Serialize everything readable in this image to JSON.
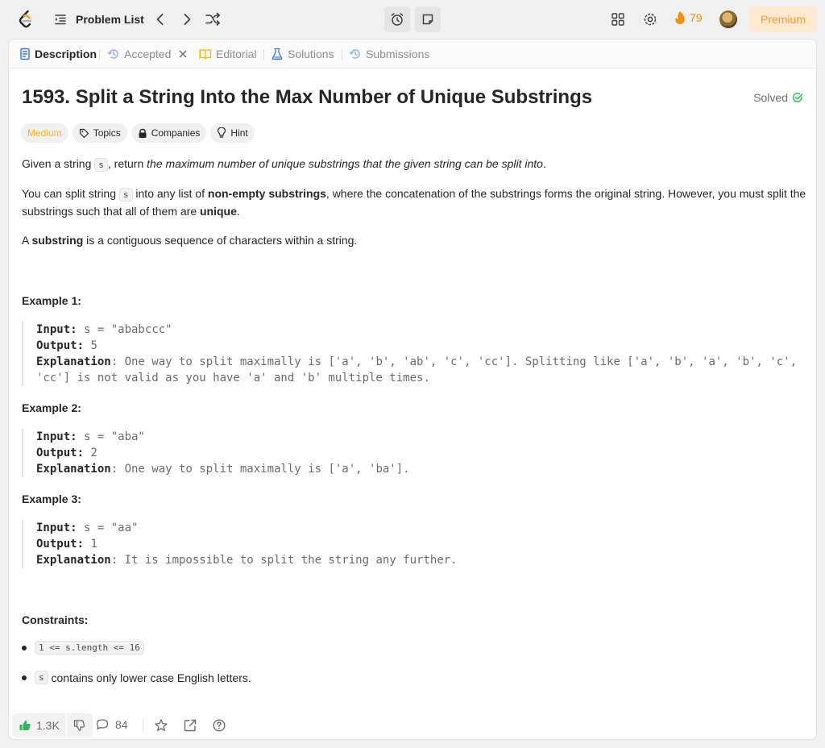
{
  "topbar": {
    "problem_list_label": "Problem List",
    "streak_count": "79",
    "premium_label": "Premium"
  },
  "tabs": [
    {
      "label": "Description",
      "icon": "document-icon",
      "active": true
    },
    {
      "label": "Accepted",
      "icon": "history-icon",
      "closable": true
    },
    {
      "label": "Editorial",
      "icon": "book-icon"
    },
    {
      "label": "Solutions",
      "icon": "flask-icon"
    },
    {
      "label": "Submissions",
      "icon": "history-icon"
    }
  ],
  "problem": {
    "title": "1593. Split a String Into the Max Number of Unique Substrings",
    "status": "Solved",
    "tags": {
      "difficulty": "Medium",
      "topics": "Topics",
      "companies": "Companies",
      "hint": "Hint"
    },
    "para1": {
      "a": "Given a string ",
      "code": "s",
      "b": ", return ",
      "em": "the maximum number of unique substrings that the given string can be split into",
      "c": "."
    },
    "para2": {
      "a": "You can split string ",
      "code": "s",
      "b": " into any list of ",
      "strong1": "non-empty substrings",
      "c": ", where the concatenation of the substrings forms the original string. However, you must split the substrings such that all of them are ",
      "strong2": "unique",
      "d": "."
    },
    "para3": {
      "a": "A ",
      "strong": "substring",
      "b": " is a contiguous sequence of characters within a string."
    }
  },
  "examples": [
    {
      "title": "Example 1:",
      "input_label": "Input:",
      "input": " s = \"ababccc\"",
      "output_label": "Output:",
      "output": " 5",
      "explanation_label": "Explanation",
      "explanation": ": One way to split maximally is ['a', 'b', 'ab', 'c', 'cc']. Splitting like ['a', 'b', 'a', 'b', 'c', 'cc'] is not valid as you have 'a' and 'b' multiple times."
    },
    {
      "title": "Example 2:",
      "input_label": "Input:",
      "input": " s = \"aba\"",
      "output_label": "Output:",
      "output": " 2",
      "explanation_label": "Explanation",
      "explanation": ": One way to split maximally is ['a', 'ba']."
    },
    {
      "title": "Example 3:",
      "input_label": "Input:",
      "input": " s = \"aa\"",
      "output_label": "Output:",
      "output": " 1",
      "explanation_label": "Explanation",
      "explanation": ": It is impossible to split the string any further."
    }
  ],
  "constraints": {
    "title": "Constraints:",
    "item1_code": "1 <= s.length <= 16",
    "item2_code": "s",
    "item2_text": " contains only lower case English letters."
  },
  "footer": {
    "likes": "1.3K",
    "comments": "84"
  },
  "colors": {
    "accent_orange": "#ffa116",
    "medium": "#ffb800",
    "solved_green": "#2cbb5d",
    "like_green": "#2db55d",
    "tab_blue": "#3c7bd8"
  }
}
